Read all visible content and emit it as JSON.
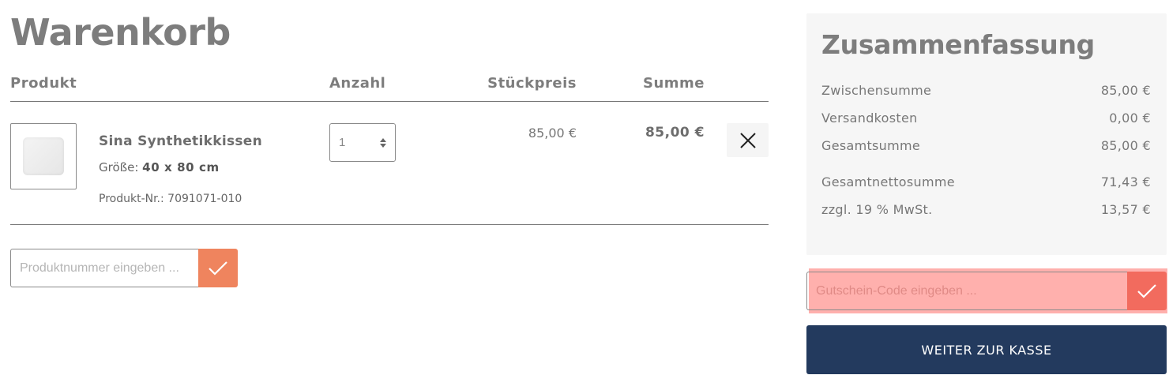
{
  "cart": {
    "title": "Warenkorb",
    "headers": {
      "product": "Produkt",
      "quantity": "Anzahl",
      "unit_price": "Stückpreis",
      "total": "Summe"
    },
    "items": [
      {
        "name": "Sina Synthetikkissen",
        "size_label": "Größe:",
        "size_value": "40 x 80 cm",
        "product_number": "Produkt-Nr.: 7091071-010",
        "quantity": "1",
        "unit_price": "85,00 €",
        "total": "85,00 €",
        "image_icon": "pillow-image"
      }
    ],
    "product_number_input": {
      "placeholder": "Produktnummer eingeben ..."
    }
  },
  "summary": {
    "title": "Zusammenfassung",
    "rows": [
      {
        "label": "Zwischensumme",
        "value": "85,00 €"
      },
      {
        "label": "Versandkosten",
        "value": "0,00 €"
      },
      {
        "label": "Gesamtsumme",
        "value": "85,00 €"
      },
      {
        "label": "Gesamtnettosumme",
        "value": "71,43 €"
      },
      {
        "label": "zzgl. 19 % MwSt.",
        "value": "13,57 €"
      }
    ],
    "coupon_input": {
      "placeholder": "Gutschein-Code eingeben ..."
    },
    "checkout_label": "WEITER ZUR KASSE"
  },
  "colors": {
    "accent": "#ef845e",
    "coupon_highlight": "#ffb0ad",
    "checkout_bg": "#233a5e",
    "summary_bg": "#f6f6f6"
  }
}
